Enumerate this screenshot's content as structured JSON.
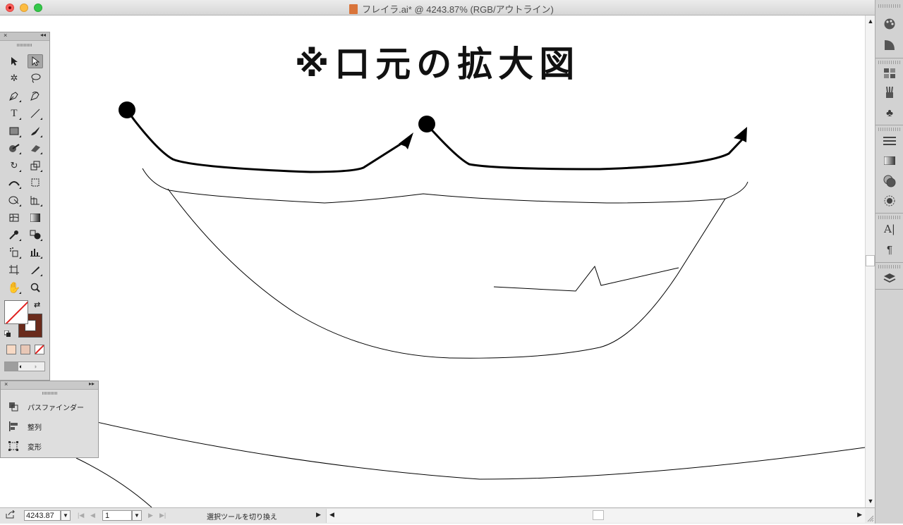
{
  "window": {
    "title": "フレイラ.ai* @ 4243.87% (RGB/アウトライン)"
  },
  "artboard": {
    "heading": "※口元の拡大図"
  },
  "statusbar": {
    "zoom": "4243.87%",
    "zoom_display": "4243.87",
    "page": "1",
    "tool_status": "選択ツールを切り換え"
  },
  "pathfinder_panel": {
    "items": [
      {
        "label": "パスファインダー",
        "icon": "pathfinder-icon"
      },
      {
        "label": "整列",
        "icon": "align-icon"
      },
      {
        "label": "変形",
        "icon": "transform-icon"
      }
    ]
  },
  "tools": {
    "rows": [
      [
        "selection-tool",
        "direct-selection-tool"
      ],
      [
        "magic-wand-tool",
        "lasso-tool"
      ],
      [
        "pen-tool",
        "curvature-pen-tool"
      ],
      [
        "type-tool",
        "line-segment-tool"
      ],
      [
        "rectangle-tool",
        "paintbrush-tool"
      ],
      [
        "shaper-tool",
        "eraser-tool"
      ],
      [
        "rotate-tool",
        "scale-tool"
      ],
      [
        "width-tool",
        "free-transform-tool"
      ],
      [
        "shape-builder-tool",
        "perspective-grid-tool"
      ],
      [
        "mesh-tool",
        "gradient-tool"
      ],
      [
        "eyedropper-tool",
        "blend-tool"
      ],
      [
        "symbol-sprayer-tool",
        "column-graph-tool"
      ],
      [
        "artboard-tool",
        "slice-tool"
      ],
      [
        "hand-tool",
        "zoom-tool"
      ]
    ],
    "fill_color": "none",
    "stroke_color": "#6a2b1c"
  },
  "right_dock": {
    "icons": [
      "color-icon",
      "color-guide-icon",
      "swatches-icon",
      "brushes-icon",
      "symbols-icon",
      "stroke-icon",
      "gradient-icon",
      "transparency-icon",
      "appearance-icon",
      "character-icon",
      "paragraph-icon",
      "layers-icon"
    ]
  }
}
